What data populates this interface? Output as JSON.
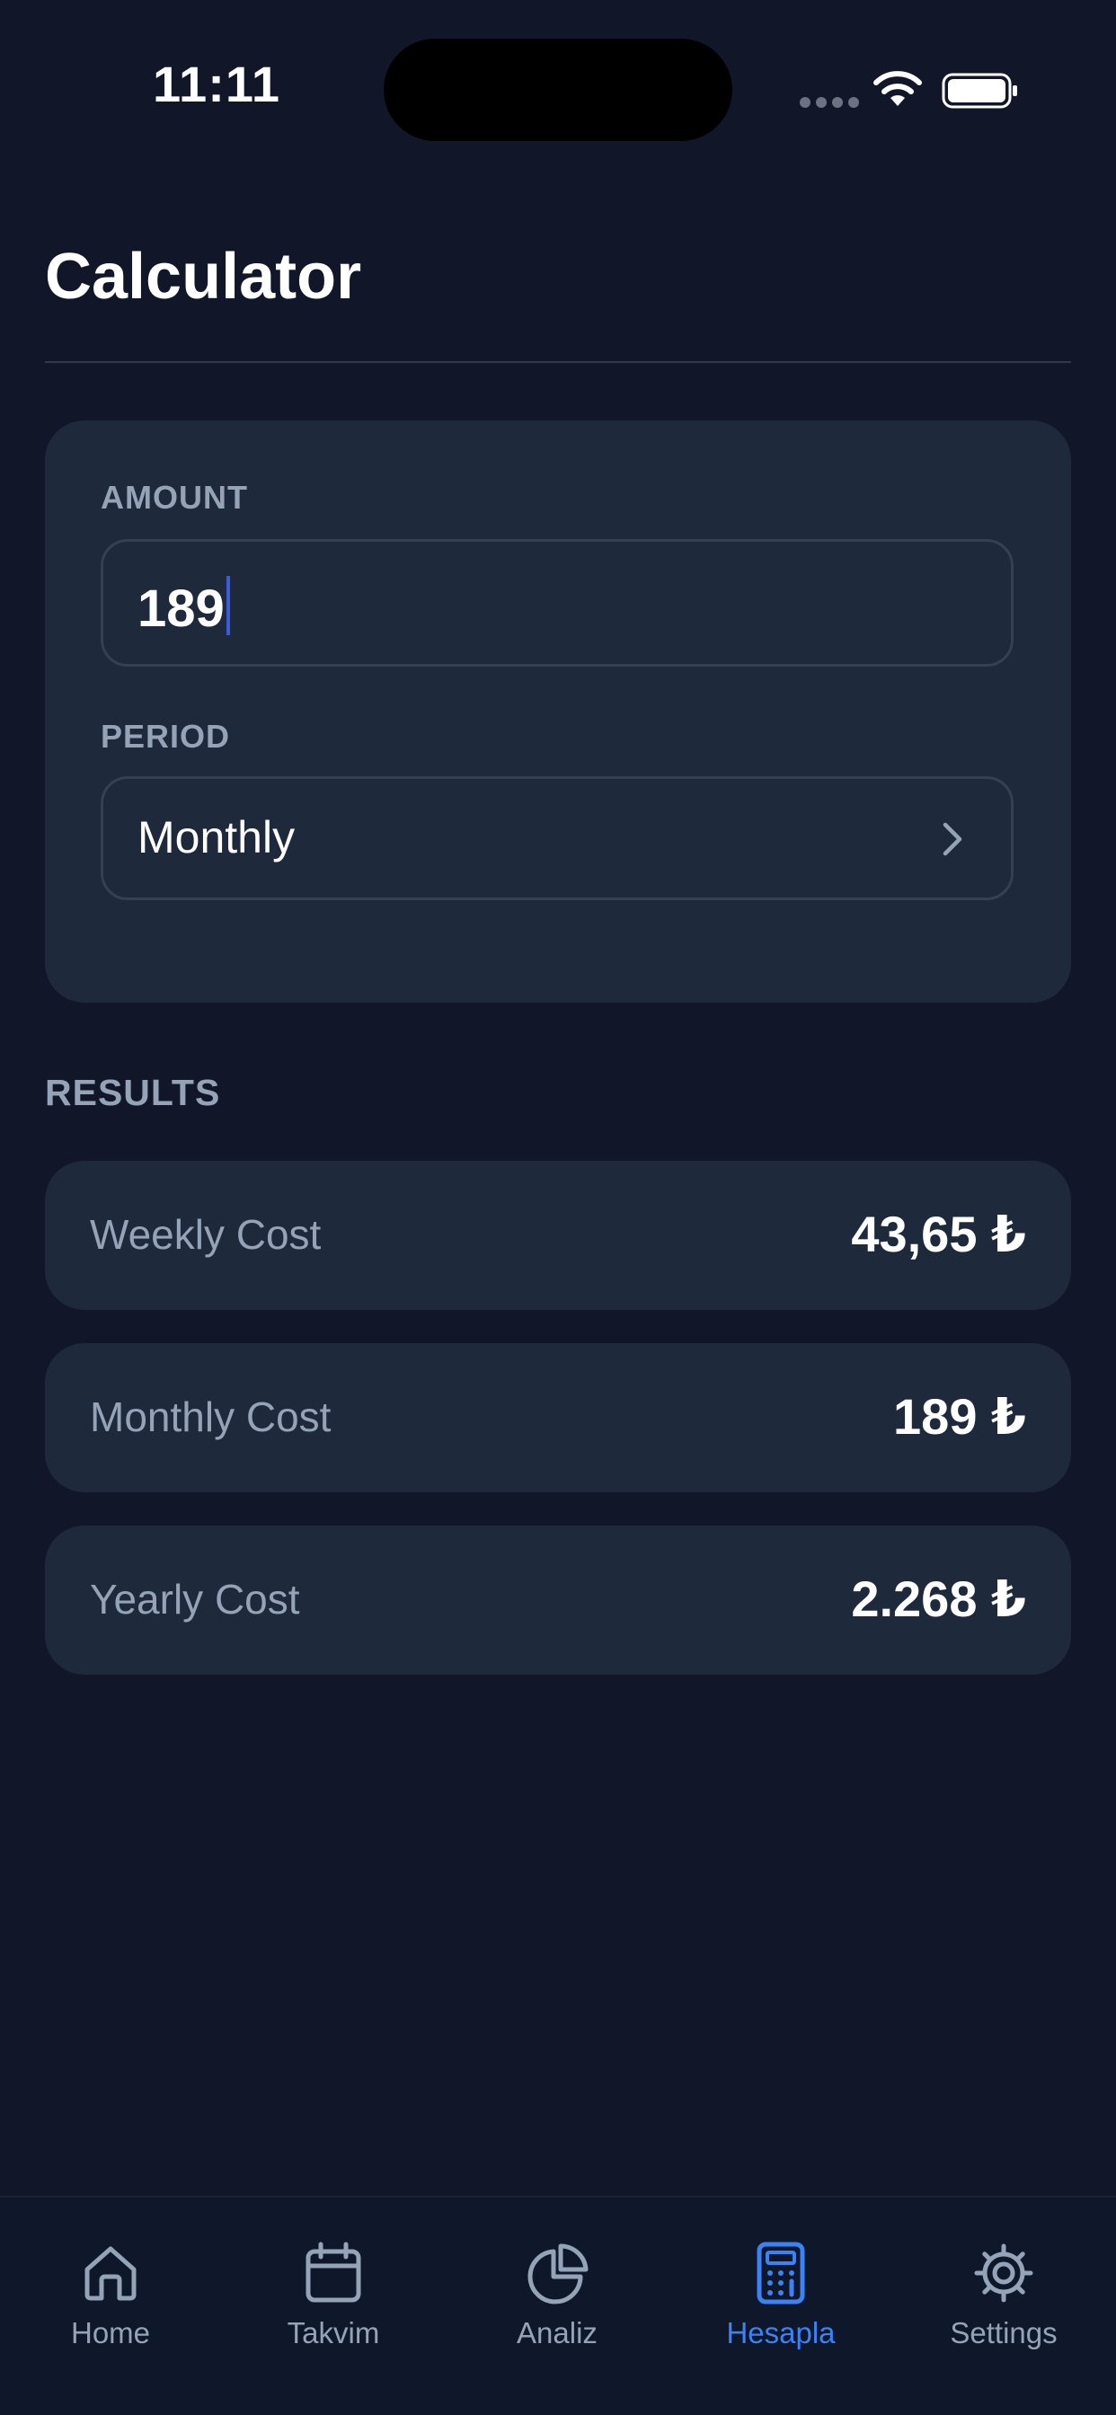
{
  "status_bar": {
    "time": "11:11"
  },
  "page": {
    "title": "Calculator"
  },
  "form": {
    "amount_label": "AMOUNT",
    "amount_value": "189",
    "period_label": "PERIOD",
    "period_value": "Monthly"
  },
  "results": {
    "heading": "RESULTS",
    "items": [
      {
        "label": "Weekly Cost",
        "value": "43,65 ₺"
      },
      {
        "label": "Monthly Cost",
        "value": "189 ₺"
      },
      {
        "label": "Yearly Cost",
        "value": "2.268 ₺"
      }
    ]
  },
  "tab_bar": {
    "active_tab": "Hesapla",
    "tabs": [
      {
        "label": "Home",
        "icon": "home-icon"
      },
      {
        "label": "Takvim",
        "icon": "calendar-icon"
      },
      {
        "label": "Analiz",
        "icon": "pie-chart-icon"
      },
      {
        "label": "Hesapla",
        "icon": "calculator-icon"
      },
      {
        "label": "Settings",
        "icon": "gear-icon"
      }
    ]
  },
  "colors": {
    "background": "#111729",
    "card": "#1e293b",
    "muted_text": "#94a3b8",
    "accent": "#3b82f6"
  }
}
